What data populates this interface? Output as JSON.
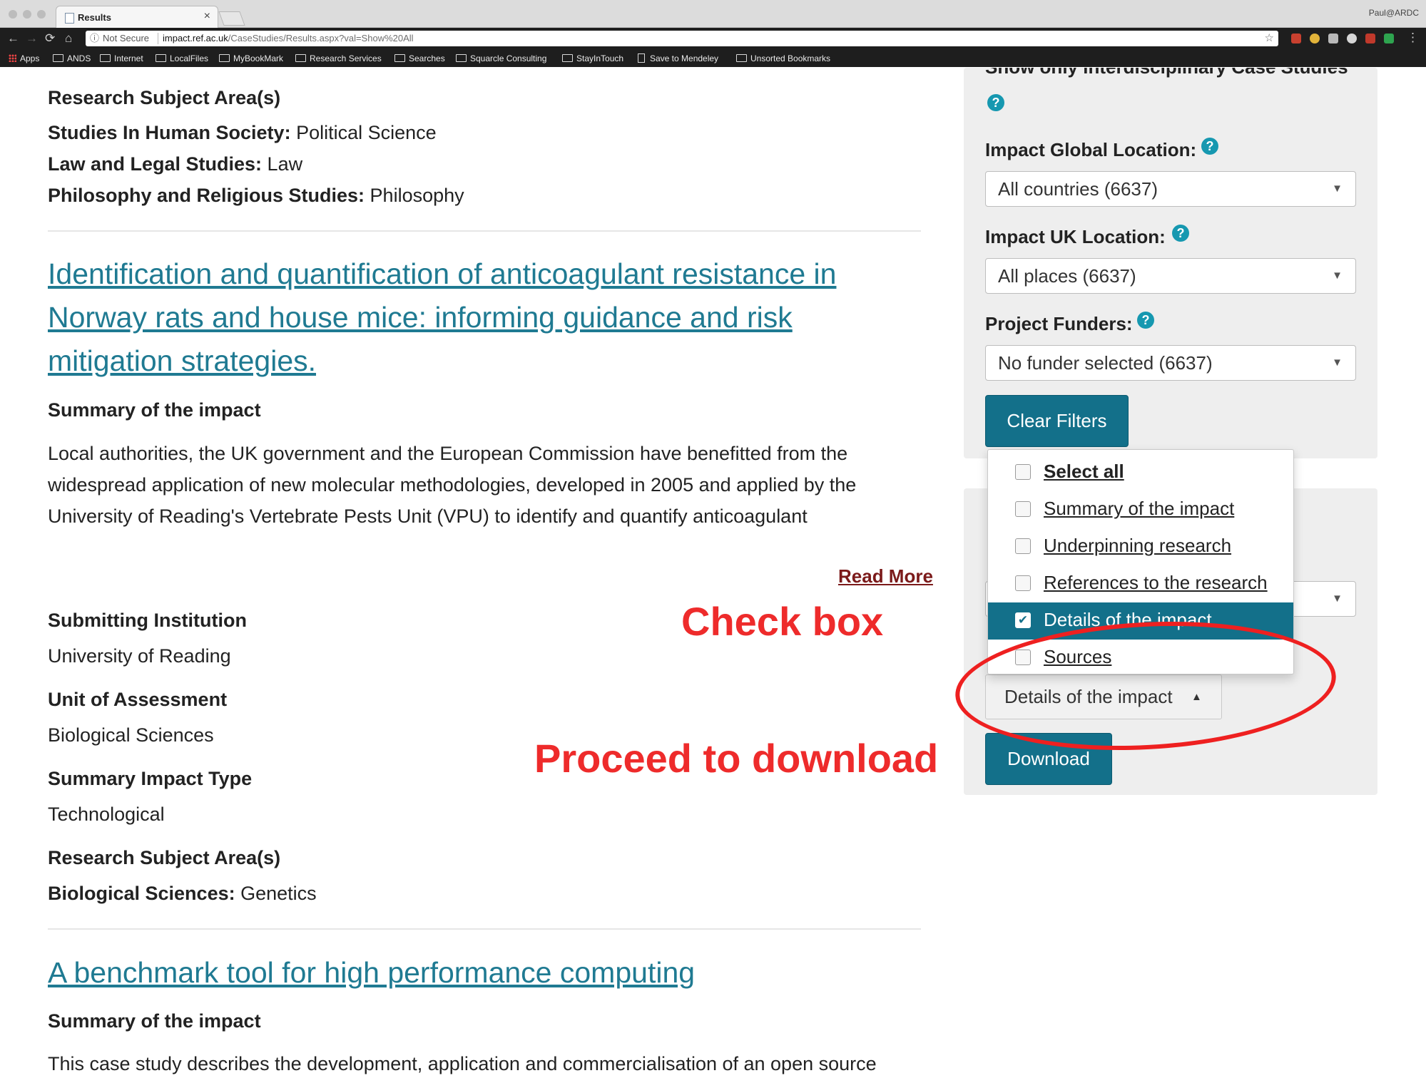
{
  "browser": {
    "tab_title": "Results",
    "tab_close": "×",
    "profile": "Paul@ARDC",
    "omnibox": {
      "security": "Not Secure",
      "host": "impact.ref.ac.uk",
      "path": "/CaseStudies/Results.aspx?val=Show%20All"
    },
    "nav": {
      "back": "←",
      "forward": "→",
      "reload": "⟳",
      "home": "⌂"
    },
    "bookmarks": [
      "Apps",
      "ANDS",
      "Internet",
      "LocalFiles",
      "MyBookMark",
      "Research Services",
      "Searches",
      "Squarcle Consulting",
      "StayInTouch",
      "Save to Mendeley",
      "Unsorted Bookmarks"
    ]
  },
  "colors": {
    "accent": "#13708a",
    "link": "#1f7a92",
    "annotation": "#ee2b2b",
    "read_more": "#7b1a1a",
    "help": "#1698b0"
  },
  "results": {
    "prev": {
      "rsa_heading": "Research Subject Area(s)",
      "areas": [
        {
          "field": "Studies In Human Society:",
          "value": " Political Science"
        },
        {
          "field": "Law and Legal Studies:",
          "value": " Law"
        },
        {
          "field": "Philosophy and Religious Studies:",
          "value": " Philosophy"
        }
      ]
    },
    "case1": {
      "title_lines": [
        "Identification and quantification of anticoagulant resistance in",
        "Norway rats and house mice: informing guidance and risk",
        "mitigation strategies."
      ],
      "summary_heading": "Summary of the impact",
      "summary_lines": [
        "Local authorities, the UK government and the European Commission have benefitted from the",
        "widespread application of new molecular methodologies, developed in 2005 and applied by the",
        "University of Reading's Vertebrate Pests Unit (VPU) to identify and quantify anticoagulant"
      ],
      "read_more": "Read More",
      "institution_heading": "Submitting Institution",
      "institution": "University of Reading",
      "uoa_heading": "Unit of Assessment",
      "uoa": "Biological Sciences",
      "impact_type_heading": "Summary Impact Type",
      "impact_type": "Technological",
      "rsa_heading": "Research Subject Area(s)",
      "rsa_field": "Biological Sciences:",
      "rsa_value": " Genetics"
    },
    "case2": {
      "title": "A benchmark tool for high performance computing",
      "summary_heading": "Summary of the impact",
      "summary_first_line": "This case study describes the development, application and commercialisation of an open source"
    }
  },
  "sidebar": {
    "interdisciplinary_label": "Show only interdisciplinary Case Studies",
    "help_glyph": "?",
    "global_location": {
      "label": "Impact Global Location:",
      "value": "All countries (6637)"
    },
    "uk_location": {
      "label": "Impact UK Location:",
      "value": "All places (6637)"
    },
    "funders": {
      "label": "Project Funders:",
      "value": "No funder selected (6637)"
    },
    "clear_filters": "Clear Filters",
    "download_section": {
      "columns_button": "Details of the impact",
      "columns_button_caret": "▲",
      "options": [
        {
          "label": "Select all",
          "checked": false,
          "bold": true
        },
        {
          "label": "Summary of the impact",
          "checked": false
        },
        {
          "label": "Underpinning research",
          "checked": false
        },
        {
          "label": "References to the research",
          "checked": false
        },
        {
          "label": "Details of the impact",
          "checked": true,
          "active": true
        },
        {
          "label": "Sources",
          "checked": false
        }
      ],
      "download_button": "Download"
    }
  },
  "annotations": {
    "check_box": "Check box",
    "proceed": "Proceed to download"
  }
}
